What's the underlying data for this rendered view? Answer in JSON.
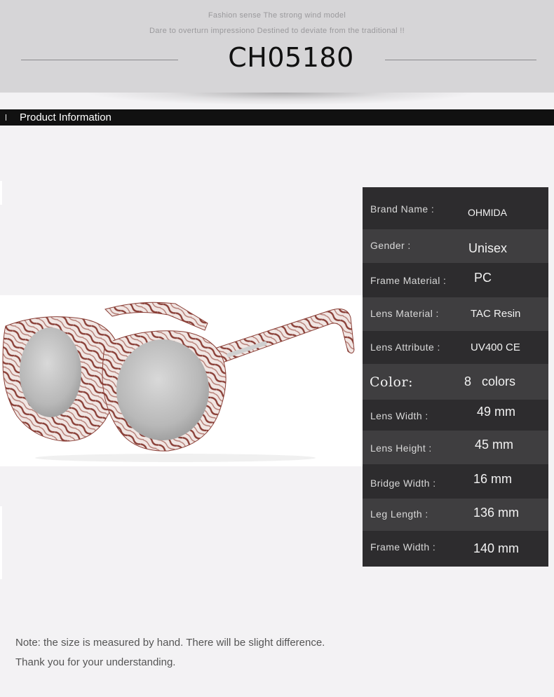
{
  "header": {
    "tagline_1": "Fashion sense The strong wind model",
    "tagline_2": "Dare to overturn impressiono Destined to deviate from the traditional !!",
    "model": "CH05180"
  },
  "section": {
    "title": "Product Information"
  },
  "specs": {
    "brand_label": "Brand Name :",
    "brand_value": "OHMIDA",
    "gender_label": "Gender :",
    "gender_value": "Unisex",
    "frame_material_label": "Frame Material :",
    "frame_material_value": "PC",
    "lens_material_label": "Lens Material :",
    "lens_material_value": "TAC Resin",
    "lens_attribute_label": "Lens Attribute :",
    "lens_attribute_value": "UV400 CE",
    "color_label": "Color:",
    "color_value": "8   colors",
    "lens_width_label": "Lens Width :",
    "lens_width_value": "49 mm",
    "lens_height_label": "Lens Height :",
    "lens_height_value": "45 mm",
    "bridge_width_label": "Bridge Width :",
    "bridge_width_value": "16 mm",
    "leg_length_label": "Leg Length :",
    "leg_length_value": "136 mm",
    "frame_width_label": "Frame Width :",
    "frame_width_value": "140 mm"
  },
  "note": {
    "line_1": "Note: the size is measured by hand. There will be slight difference.",
    "line_2": "Thank you for your understanding."
  },
  "colors": {
    "panel_dark": "#2d2c2e",
    "panel_light": "#3f3e40",
    "section_bar": "#111111",
    "frame_pattern": "#8a3f37",
    "lens": "#c9c9c9"
  }
}
